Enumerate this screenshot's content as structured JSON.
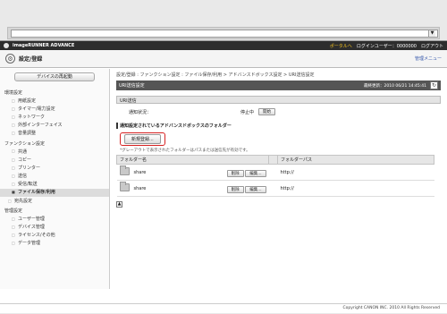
{
  "browser": {
    "address_value": "",
    "dropdown_glyph": "▼"
  },
  "brand_bar": {
    "product": "imageRUNNER ADVANCE",
    "portal_link": "ポータルへ",
    "user": "ログインユーザー：0000000",
    "logout": "ログアウト"
  },
  "title_bar": {
    "title": "設定/登録",
    "menu_link": "管理メニュー"
  },
  "sidebar": {
    "device_button": "デバイスの再起動",
    "sections": [
      {
        "label": "環境設定",
        "items": [
          {
            "label": "用紙設定"
          },
          {
            "label": "タイマー/電力設定"
          },
          {
            "label": "ネットワーク"
          },
          {
            "label": "外部インターフェイス"
          },
          {
            "label": "音量調整"
          }
        ]
      },
      {
        "label": "ファンクション設定",
        "items": [
          {
            "label": "共通"
          },
          {
            "label": "コピー"
          },
          {
            "label": "プリンター"
          },
          {
            "label": "送信"
          },
          {
            "label": "受信/転送"
          },
          {
            "label": "ファイル保存/利用",
            "active": true
          }
        ]
      },
      {
        "label": "宛先設定",
        "items": []
      },
      {
        "label": "管理設定",
        "items": [
          {
            "label": "ユーザー管理"
          },
          {
            "label": "デバイス管理"
          },
          {
            "label": "ライセンス/その他"
          },
          {
            "label": "データ管理"
          }
        ]
      }
    ]
  },
  "main": {
    "breadcrumb": "設定/登録 : ファンクション設定 : ファイル保存/利用 > アドバンスドボックス設定 > URI送信設定",
    "page_title": "URI送信設定",
    "last_updated": "最終更新：2010 06/21 14:45:41",
    "refresh_icon": "↻",
    "uri_section_label": "URI送信",
    "notify_label": "通知状況：",
    "notify_status": "停止中",
    "start_button": "開始",
    "folders_heading": "通知設定されているアドバンスドボックスのフォルダー",
    "new_register_button": "新規登録...",
    "note": "*グレーアウトで表示されたフォルダーはパスまたは送信先が有効です。",
    "table": {
      "headers": [
        "フォルダー名",
        "",
        "フォルダーパス"
      ],
      "rows": [
        {
          "name": "share",
          "delete": "削除",
          "edit": "編集...",
          "path": "http://"
        },
        {
          "name": "share",
          "delete": "削除",
          "edit": "編集...",
          "path": "http://"
        }
      ]
    },
    "top_icon": "▲"
  },
  "footer": {
    "copyright": "Copyright CANON INC. 2010 All Rights Reserved"
  }
}
